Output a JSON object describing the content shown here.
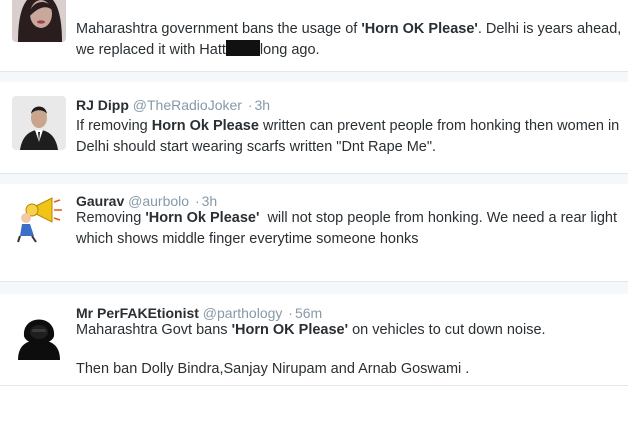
{
  "tweets": [
    {
      "avatar_icon": "woman-portrait-icon",
      "segments": [
        "Maharashtra government bans the usage of ",
        "'Horn OK Please'",
        ". Delhi is years ahead, we replaced it with Hatt",
        "long ago."
      ]
    },
    {
      "name": "RJ Dipp",
      "handle": "@TheRadioJoker",
      "time": "3h",
      "avatar_icon": "man-in-suit-icon",
      "segments": [
        "If removing ",
        "Horn Ok Please",
        " written can prevent people from honking then women in Delhi should start wearing scarfs written \"Dnt Rape Me\"."
      ]
    },
    {
      "name": "Gaurav",
      "handle": "@aurbolo",
      "time": "3h",
      "avatar_icon": "cartoon-megaphone-icon",
      "segments": [
        "Removing ",
        "'Horn Ok Please'",
        "  will not stop people from honking. We need a rear light which shows middle finger everytime someone honks"
      ]
    },
    {
      "name": "Mr PerFAKEtionist",
      "handle": "@parthology",
      "time": "56m",
      "avatar_icon": "hooded-silhouette-icon",
      "segments": [
        "Maharashtra Govt bans ",
        "'Horn OK Please'",
        " on vehicles to cut down noise."
      ],
      "second_paragraph": "Then ban Dolly Bindra,Sanjay Nirupam and Arnab Goswami ."
    }
  ],
  "separator": "·",
  "colors": {
    "background": "#ffffff",
    "gap": "#f5f8fa",
    "text": "#292f33",
    "muted": "#8899a6"
  }
}
